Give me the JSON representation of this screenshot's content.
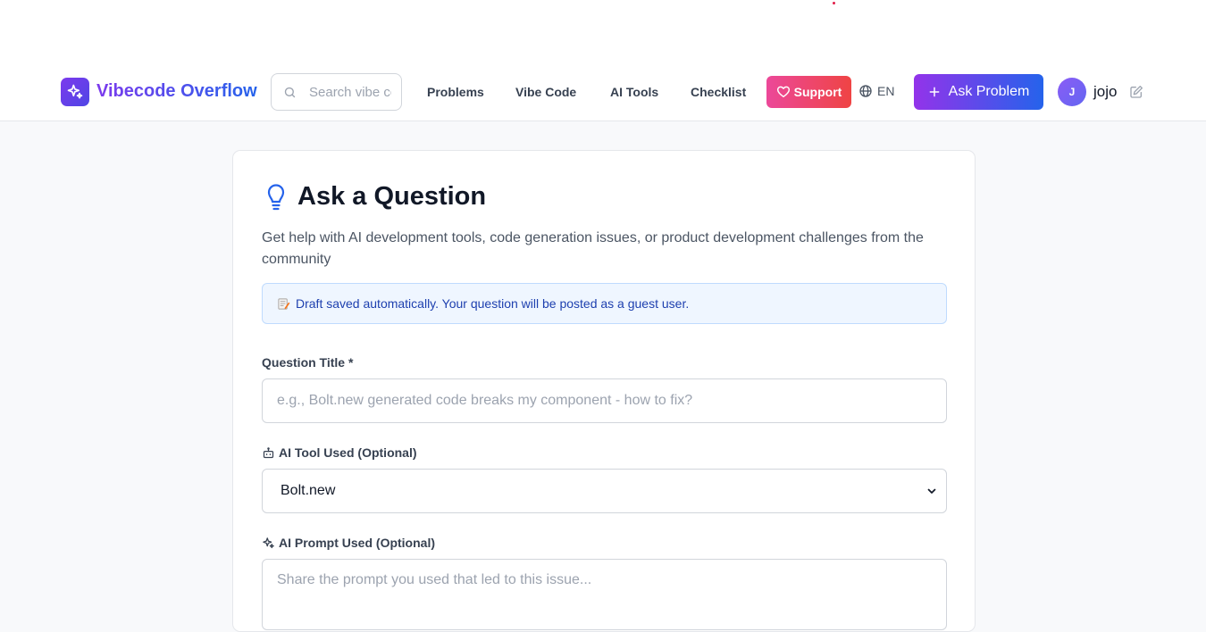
{
  "brand": {
    "name": "Vibecode Overflow"
  },
  "search": {
    "placeholder": "Search vibe code problems..."
  },
  "nav": {
    "links": [
      "Problems",
      "Vibe Code",
      "AI Tools",
      "Checklist"
    ],
    "support_label": "Support",
    "language": "EN",
    "ask_label": "Ask Problem"
  },
  "user": {
    "initial": "J",
    "name": "jojo"
  },
  "form": {
    "title": "Ask a Question",
    "subtitle": "Get help with AI development tools, code generation issues, or product development challenges from the community",
    "draft_notice": "Draft saved automatically. Your question will be posted as a guest user.",
    "question_title_label": "Question Title *",
    "question_title_placeholder": "e.g., Bolt.new generated code breaks my component - how to fix?",
    "ai_tool_label": "AI Tool Used (Optional)",
    "ai_tool_value": "Bolt.new",
    "ai_prompt_label": "AI Prompt Used (Optional)",
    "ai_prompt_placeholder": "Share the prompt you used that led to this issue..."
  },
  "colors": {
    "brand_purple": "#7c3aed",
    "brand_blue": "#2563eb",
    "support_pink": "#ec4899",
    "notice_bg": "#eff6ff"
  }
}
